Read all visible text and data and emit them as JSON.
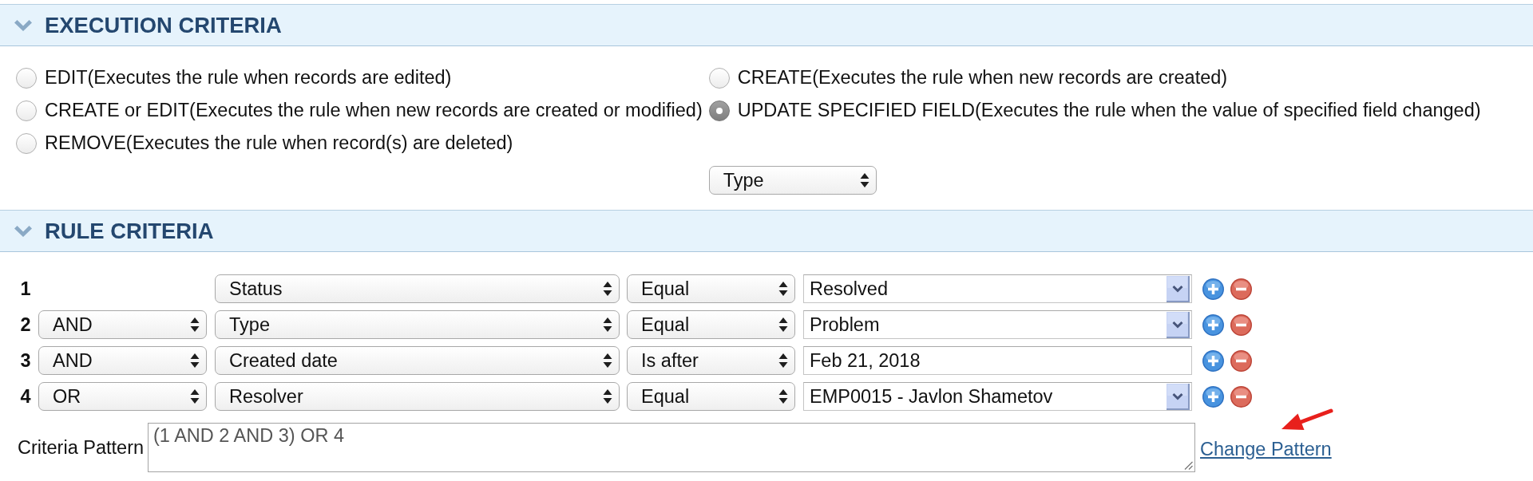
{
  "execution_criteria": {
    "title": "EXECUTION CRITERIA",
    "expanded": true,
    "options": [
      {
        "label": "EDIT(Executes the rule when records are edited)",
        "selected": false
      },
      {
        "label": "CREATE(Executes the rule when new records are created)",
        "selected": false
      },
      {
        "label": "CREATE or EDIT(Executes the rule when new records are created or modified)",
        "selected": false
      },
      {
        "label": "UPDATE SPECIFIED FIELD(Executes the rule when the value of specified field changed)",
        "selected": true
      },
      {
        "label": "REMOVE(Executes the rule when record(s) are deleted)",
        "selected": false
      }
    ],
    "specified_field": "Type"
  },
  "rule_criteria": {
    "title": "RULE CRITERIA",
    "expanded": true,
    "rows": [
      {
        "number": "1",
        "field": "Status",
        "operator": "Equal",
        "value": "Resolved",
        "kind": "lookup"
      },
      {
        "number": "2",
        "connector": "AND",
        "field": "Type",
        "operator": "Equal",
        "value": "Problem",
        "kind": "lookup"
      },
      {
        "number": "3",
        "connector": "AND",
        "field": "Created date",
        "operator": "Is after",
        "value": "Feb 21, 2018",
        "kind": "text"
      },
      {
        "number": "4",
        "connector": "OR",
        "field": "Resolver",
        "operator": "Equal",
        "value": "EMP0015 - Javlon Shametov",
        "kind": "lookup"
      }
    ],
    "pattern_label": "Criteria Pattern",
    "pattern": "(1 AND 2 AND 3) OR 4",
    "change_pattern_link": "Change Pattern"
  }
}
